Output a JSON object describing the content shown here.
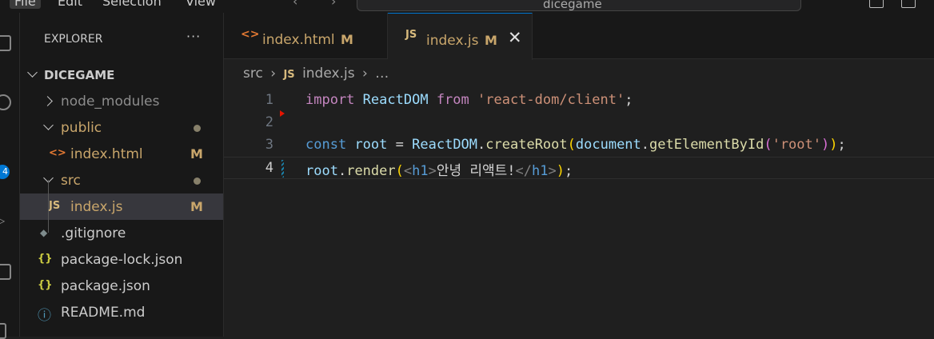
{
  "menubar": {
    "items": [
      "File",
      "Edit",
      "Selection",
      "View"
    ],
    "command_center": "dicegame"
  },
  "activity_bar": {
    "badge_count": "4"
  },
  "explorer": {
    "title": "EXPLORER",
    "more_label": "···",
    "project": "DICEGAME",
    "tree": [
      {
        "label": "node_modules",
        "type": "folder",
        "state": "collapsed"
      },
      {
        "label": "public",
        "type": "folder",
        "state": "expanded",
        "status": "dot"
      },
      {
        "label": "index.html",
        "type": "html",
        "status": "M",
        "icon": "<>"
      },
      {
        "label": "src",
        "type": "folder",
        "state": "expanded",
        "status": "dot"
      },
      {
        "label": "index.js",
        "type": "js",
        "status": "M",
        "icon": "JS",
        "selected": true
      },
      {
        "label": ".gitignore",
        "type": "git",
        "icon": "◆"
      },
      {
        "label": "package-lock.json",
        "type": "json",
        "icon": "{}"
      },
      {
        "label": "package.json",
        "type": "json",
        "icon": "{}"
      },
      {
        "label": "README.md",
        "type": "info",
        "icon": "ⓘ"
      }
    ]
  },
  "tabs": [
    {
      "name": "index.html",
      "icon": "<>",
      "status": "M",
      "active": false
    },
    {
      "name": "index.js",
      "icon": "JS",
      "status": "M",
      "active": true,
      "close": "✕"
    }
  ],
  "breadcrumb": {
    "folder": "src",
    "sep": "›",
    "icon": "JS",
    "file": "index.js",
    "tail": "…"
  },
  "code": {
    "line_numbers": [
      "1",
      "2",
      "3",
      "4"
    ],
    "l1": {
      "a": "import",
      "b": "ReactDOM",
      "c": "from",
      "d": "'react-dom/client'",
      "e": ";"
    },
    "l3": {
      "a": "const",
      "b": "root",
      "c": "=",
      "d": "ReactDOM",
      "e": ".",
      "f": "createRoot",
      "g": "(",
      "h": "document",
      "i": ".",
      "j": "getElementById",
      "k": "(",
      "l": "'root'",
      "m": ")",
      "n": ")",
      "o": ";"
    },
    "l4": {
      "a": "root",
      "b": ".",
      "c": "render",
      "d": "(",
      "e": "<",
      "f": "h1",
      "g": ">",
      "h": "안녕 리액트!",
      "i": "</",
      "j": "h1",
      "k": ">",
      "l": ")",
      "m": ";"
    }
  },
  "colors": {
    "accent": "#0078d4",
    "modified": "#c9a66b",
    "js_icon": "#d7ba7d",
    "html_icon": "#e37933",
    "json_icon": "#cbcb41",
    "info_icon": "#519aba"
  }
}
